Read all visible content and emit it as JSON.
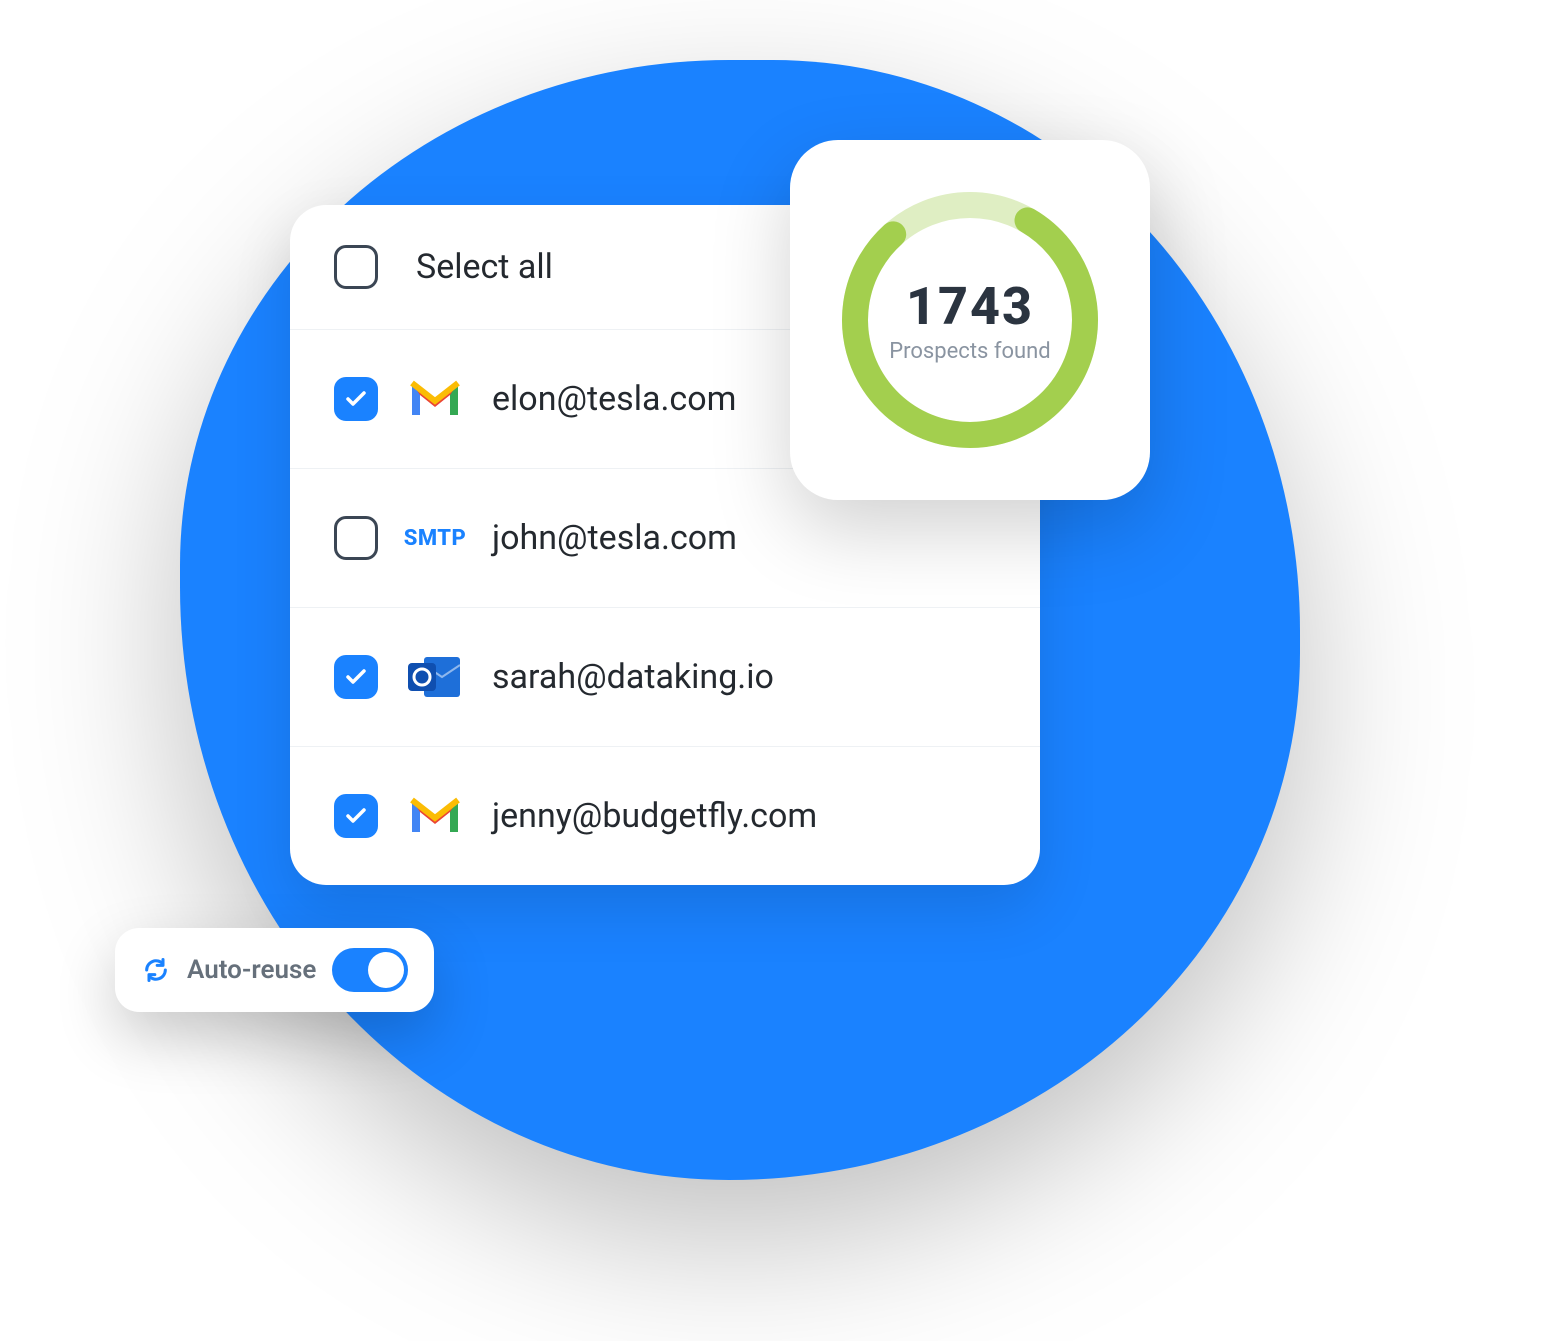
{
  "select_all_label": "Select all",
  "rows": [
    {
      "checked": true,
      "provider": "gmail",
      "email": "elon@tesla.com"
    },
    {
      "checked": false,
      "provider": "smtp",
      "email": "john@tesla.com",
      "smtp_label": "SMTP"
    },
    {
      "checked": true,
      "provider": "outlook",
      "email": "sarah@dataking.io"
    },
    {
      "checked": true,
      "provider": "gmail",
      "email": "jenny@budgetfly.com"
    }
  ],
  "stats": {
    "value": "1743",
    "label": "Prospects found",
    "progress": 0.8
  },
  "auto_reuse": {
    "label": "Auto-reuse",
    "enabled": true
  },
  "colors": {
    "accent": "#1a82ff",
    "ring": "#a3cf4e",
    "ring_track": "#dfeec3"
  }
}
